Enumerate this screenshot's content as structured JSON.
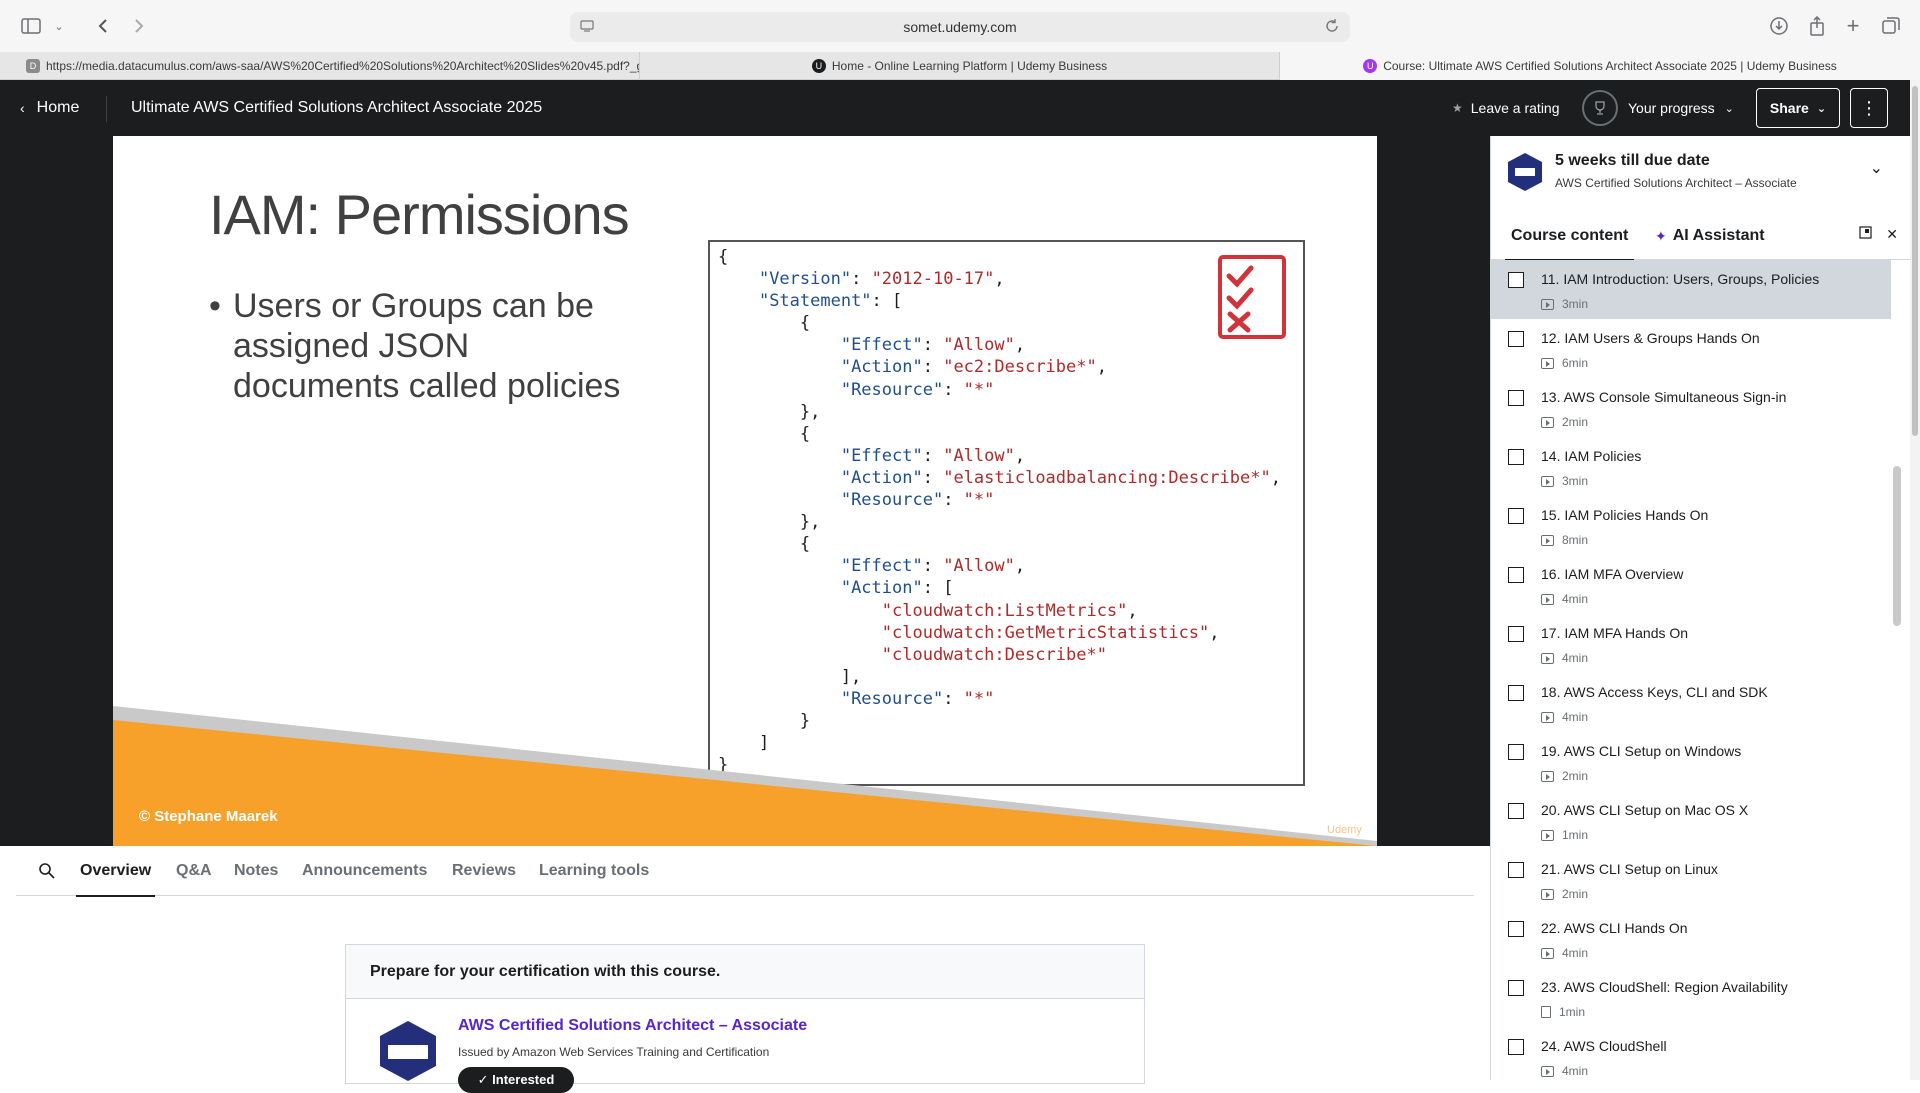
{
  "browser": {
    "address": "somet.udemy.com",
    "tabs": [
      {
        "label": "https://media.datacumulus.com/aws-saa/AWS%20Certified%20Solutions%20Architect%20Slides%20v45.pdf?_g...",
        "favicon": "D"
      },
      {
        "label": "Home - Online Learning Platform | Udemy Business",
        "favicon": "U"
      },
      {
        "label": "Course: Ultimate AWS Certified Solutions Architect Associate 2025 | Udemy Business",
        "favicon": "U"
      }
    ]
  },
  "header": {
    "home_label": "Home",
    "course_title": "Ultimate AWS Certified Solutions Architect Associate 2025",
    "rating_label": "Leave a rating",
    "progress_label": "Your progress",
    "share_label": "Share"
  },
  "slide": {
    "title": "IAM: Permissions",
    "bullet": "Users or Groups can be assigned JSON documents called policies",
    "copyright": "© Stephane Maarek",
    "watermark": "Udemy"
  },
  "sidebar": {
    "due_title": "5 weeks till due date",
    "due_sub": "AWS Certified Solutions Architect – Associate",
    "tab_course": "Course content",
    "tab_ai": "AI Assistant",
    "lectures": [
      {
        "title": "11. IAM Introduction: Users, Groups, Policies",
        "duration": "3min",
        "type": "video",
        "current": true
      },
      {
        "title": "12. IAM Users & Groups Hands On",
        "duration": "6min",
        "type": "video"
      },
      {
        "title": "13. AWS Console Simultaneous Sign-in",
        "duration": "2min",
        "type": "video"
      },
      {
        "title": "14. IAM Policies",
        "duration": "3min",
        "type": "video"
      },
      {
        "title": "15. IAM Policies Hands On",
        "duration": "8min",
        "type": "video"
      },
      {
        "title": "16. IAM MFA Overview",
        "duration": "4min",
        "type": "video"
      },
      {
        "title": "17. IAM MFA Hands On",
        "duration": "4min",
        "type": "video"
      },
      {
        "title": "18. AWS Access Keys, CLI and SDK",
        "duration": "4min",
        "type": "video"
      },
      {
        "title": "19. AWS CLI Setup on Windows",
        "duration": "2min",
        "type": "video"
      },
      {
        "title": "20. AWS CLI Setup on Mac OS X",
        "duration": "1min",
        "type": "video"
      },
      {
        "title": "21. AWS CLI Setup on Linux",
        "duration": "2min",
        "type": "video"
      },
      {
        "title": "22. AWS CLI Hands On",
        "duration": "4min",
        "type": "video"
      },
      {
        "title": "23. AWS CloudShell: Region Availability",
        "duration": "1min",
        "type": "doc"
      },
      {
        "title": "24. AWS CloudShell",
        "duration": "4min",
        "type": "video"
      }
    ]
  },
  "content_tabs": [
    "Overview",
    "Q&A",
    "Notes",
    "Announcements",
    "Reviews",
    "Learning tools"
  ],
  "cert": {
    "heading": "Prepare for your certification with this course.",
    "name": "AWS Certified Solutions Architect – Associate",
    "issuer": "Issued by Amazon Web Services Training and Certification",
    "pill": "✓ Interested"
  },
  "colors": {
    "header_bg": "#1c1d1f",
    "accent_purple": "#5624d0",
    "slide_orange": "#f7a12b",
    "code_key_blue": "#1f4f8f",
    "code_string_red": "#b02a2a",
    "checklist_red": "#d0343a"
  },
  "icons": {
    "sidebar_toggle": "sidebar-icon",
    "back": "chevron-left-icon",
    "forward": "chevron-right-icon",
    "download": "download-icon",
    "share": "share-icon",
    "new_tab": "plus-icon",
    "tab_overview": "tabs-icon",
    "star": "star-icon",
    "trophy": "trophy-icon",
    "kebab": "more-vertical-icon",
    "search": "search-icon"
  }
}
